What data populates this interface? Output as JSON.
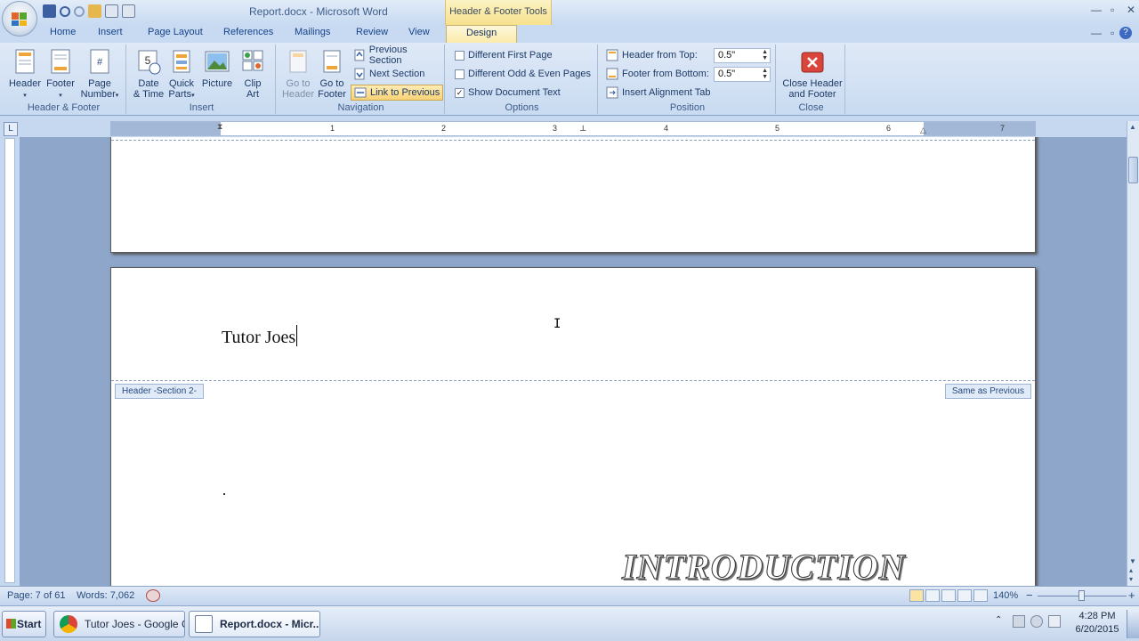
{
  "window": {
    "title": "Report.docx - Microsoft Word",
    "contextual_tab_group": "Header & Footer Tools"
  },
  "tabs": [
    "Home",
    "Insert",
    "Page Layout",
    "References",
    "Mailings",
    "Review",
    "View",
    "Design"
  ],
  "active_tab": "Design",
  "ribbon": {
    "groups": {
      "header_footer": {
        "label": "Header & Footer",
        "header": "Header",
        "footer": "Footer",
        "page_number_1": "Page",
        "page_number_2": "Number"
      },
      "insert": {
        "label": "Insert",
        "date_time_1": "Date",
        "date_time_2": "& Time",
        "quick_parts_1": "Quick",
        "quick_parts_2": "Parts",
        "picture": "Picture",
        "clip_art_1": "Clip",
        "clip_art_2": "Art"
      },
      "navigation": {
        "label": "Navigation",
        "go_to_header_1": "Go to",
        "go_to_header_2": "Header",
        "go_to_footer_1": "Go to",
        "go_to_footer_2": "Footer",
        "previous_section": "Previous Section",
        "next_section": "Next Section",
        "link_to_previous": "Link to Previous"
      },
      "options": {
        "label": "Options",
        "different_first_page": "Different First Page",
        "different_odd_even": "Different Odd & Even Pages",
        "show_document_text": "Show Document Text",
        "show_document_text_checked": "✓"
      },
      "position": {
        "label": "Position",
        "header_from_top": "Header from Top:",
        "header_from_top_value": "0.5\"",
        "footer_from_bottom": "Footer from Bottom:",
        "footer_from_bottom_value": "0.5\"",
        "insert_alignment_tab": "Insert Alignment Tab"
      },
      "close": {
        "label": "Close",
        "close_1": "Close Header",
        "close_2": "and Footer"
      }
    }
  },
  "ruler": {
    "corner": "L",
    "numbers": [
      "1",
      "2",
      "3",
      "4",
      "5",
      "6",
      "7"
    ]
  },
  "document": {
    "header_text": "Tutor Joes",
    "header_tag": "Header -Section 2-",
    "same_as_previous": "Same as Previous",
    "body_heading": "INTRODUCTION"
  },
  "statusbar": {
    "page": "Page: 7 of 61",
    "words": "Words: 7,062",
    "zoom": "140%",
    "zoom_minus": "−",
    "zoom_plus": "+"
  },
  "taskbar": {
    "start": "Start",
    "buttons": [
      "Tutor Joes - Google C...",
      "Report.docx - Micr..."
    ],
    "time": "4:28 PM",
    "date": "6/20/2015"
  }
}
